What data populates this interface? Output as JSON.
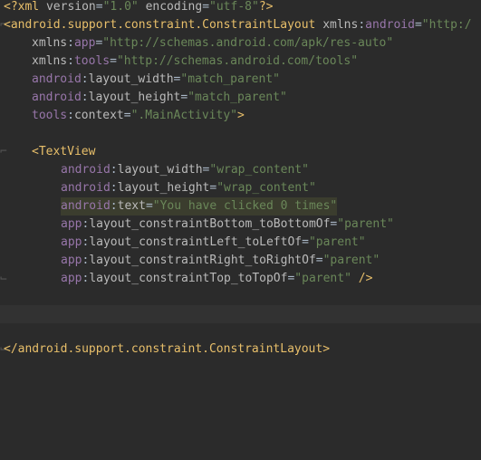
{
  "editor": {
    "theme_colors": {
      "background": "#2b2b2b",
      "tag": "#e8bf6a",
      "namespace": "#9876aa",
      "attribute": "#bababa",
      "string": "#6a8759",
      "current_line": "#323232"
    },
    "lines": [
      {
        "decl_open": "<?",
        "decl_name": "xml",
        "a1": "version",
        "v1": "\"1.0\"",
        "a2": "encoding",
        "v2": "\"utf-8\"",
        "decl_close": "?>"
      },
      {
        "tag_open": "<android.support.constraint.ConstraintLayout",
        "ns": "xmlns",
        "colon": ":",
        "attr": "android",
        "eq": "=",
        "val": "\"http:/"
      },
      {
        "ns": "xmlns",
        "colon": ":",
        "attr": "app",
        "eq": "=",
        "val": "\"http://schemas.android.com/apk/res-auto\""
      },
      {
        "ns": "xmlns",
        "colon": ":",
        "attr": "tools",
        "eq": "=",
        "val": "\"http://schemas.android.com/tools\""
      },
      {
        "ns": "android",
        "colon": ":",
        "attr": "layout_width",
        "eq": "=",
        "val": "\"match_parent\""
      },
      {
        "ns": "android",
        "colon": ":",
        "attr": "layout_height",
        "eq": "=",
        "val": "\"match_parent\""
      },
      {
        "ns": "tools",
        "colon": ":",
        "attr": "context",
        "eq": "=",
        "val": "\".MainActivity\"",
        "close": ">"
      },
      {},
      {
        "tag_open": "<TextView"
      },
      {
        "ns": "android",
        "colon": ":",
        "attr": "layout_width",
        "eq": "=",
        "val": "\"wrap_content\""
      },
      {
        "ns": "android",
        "colon": ":",
        "attr": "layout_height",
        "eq": "=",
        "val": "\"wrap_content\""
      },
      {
        "ns": "android",
        "colon": ":",
        "attr": "text",
        "eq": "=",
        "val": "\"You have clicked 0 times\""
      },
      {
        "ns": "app",
        "colon": ":",
        "attr": "layout_constraintBottom_toBottomOf",
        "eq": "=",
        "val": "\"parent\""
      },
      {
        "ns": "app",
        "colon": ":",
        "attr": "layout_constraintLeft_toLeftOf",
        "eq": "=",
        "val": "\"parent\""
      },
      {
        "ns": "app",
        "colon": ":",
        "attr": "layout_constraintRight_toRightOf",
        "eq": "=",
        "val": "\"parent\""
      },
      {
        "ns": "app",
        "colon": ":",
        "attr": "layout_constraintTop_toTopOf",
        "eq": "=",
        "val": "\"parent\"",
        "close": " />"
      },
      {},
      {},
      {},
      {
        "tag_open": "</android.support.constraint.ConstraintLayout>"
      }
    ]
  }
}
